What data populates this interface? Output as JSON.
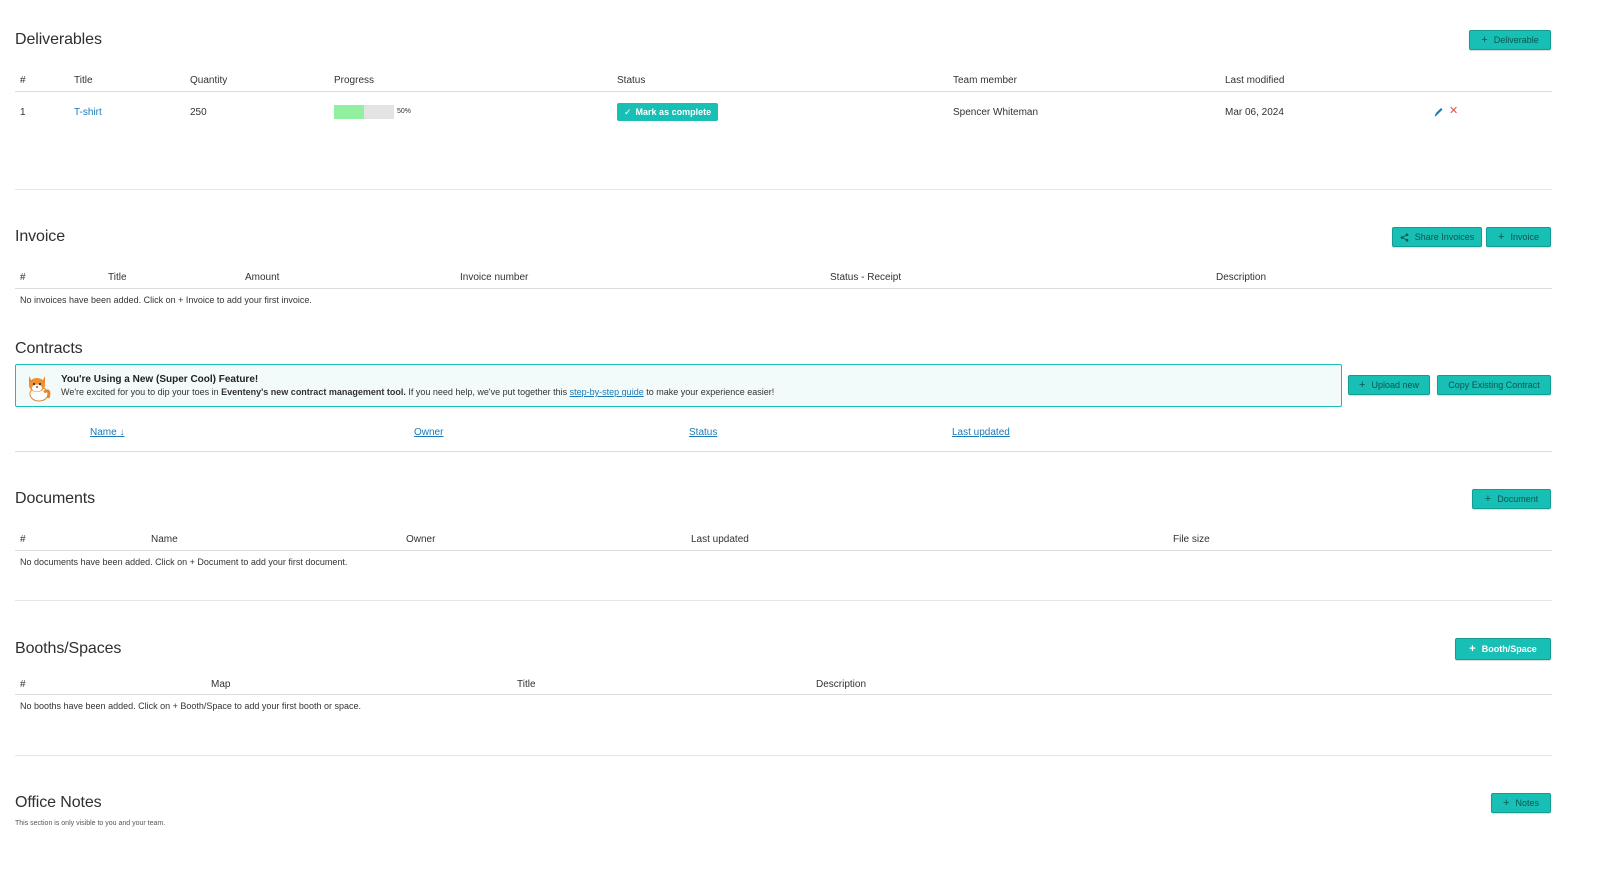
{
  "deliverables": {
    "title": "Deliverables",
    "add_button": "Deliverable",
    "columns": [
      "#",
      "Title",
      "Quantity",
      "Progress",
      "Status",
      "Team member",
      "Last modified"
    ],
    "rows": [
      {
        "num": "1",
        "title": "T-shirt",
        "quantity": "250",
        "progress": 0.5,
        "progress_label": "50%",
        "status_button": "Mark as complete",
        "team_member": "Spencer Whiteman",
        "last_modified": "Mar 06, 2024"
      }
    ]
  },
  "invoice": {
    "title": "Invoice",
    "share_button": "Share Invoices",
    "add_button": "Invoice",
    "columns": [
      "#",
      "Title",
      "Amount",
      "Invoice number",
      "Status - Receipt",
      "Description"
    ],
    "empty_text": "No invoices have been added. Click on + Invoice to add your first invoice."
  },
  "contracts": {
    "title": "Contracts",
    "banner": {
      "title": "You're Using a New (Super Cool) Feature!",
      "text_before": "We're excited for you to dip your toes in ",
      "text_bold": "Eventeny's new contract management tool.",
      "text_middle": " If you need help, we've put together this ",
      "link_text": "step-by-step guide",
      "text_after": " to make your experience easier!"
    },
    "upload_button": "Upload new",
    "copy_button": "Copy Existing Contract",
    "sort_columns": [
      "Name",
      "Owner",
      "Status",
      "Last updated"
    ],
    "sort_indicator": "↓"
  },
  "documents": {
    "title": "Documents",
    "add_button": "Document",
    "columns": [
      "#",
      "Name",
      "Owner",
      "Last updated",
      "File size"
    ],
    "empty_text": "No documents have been added. Click on + Document to add your first document."
  },
  "booths": {
    "title": "Booths/Spaces",
    "add_button": "Booth/Space",
    "columns": [
      "#",
      "Map",
      "Title",
      "Description"
    ],
    "empty_text": "No booths have been added. Click on + Booth/Space to add your first booth or space."
  },
  "office_notes": {
    "title": "Office Notes",
    "add_button": "Notes",
    "subtitle": "This section is only visible to you and your team."
  },
  "colors": {
    "accent": "#17bfb4",
    "link": "#1a7ab8",
    "progress_fill": "#90f0a0",
    "delete": "#e05050"
  }
}
